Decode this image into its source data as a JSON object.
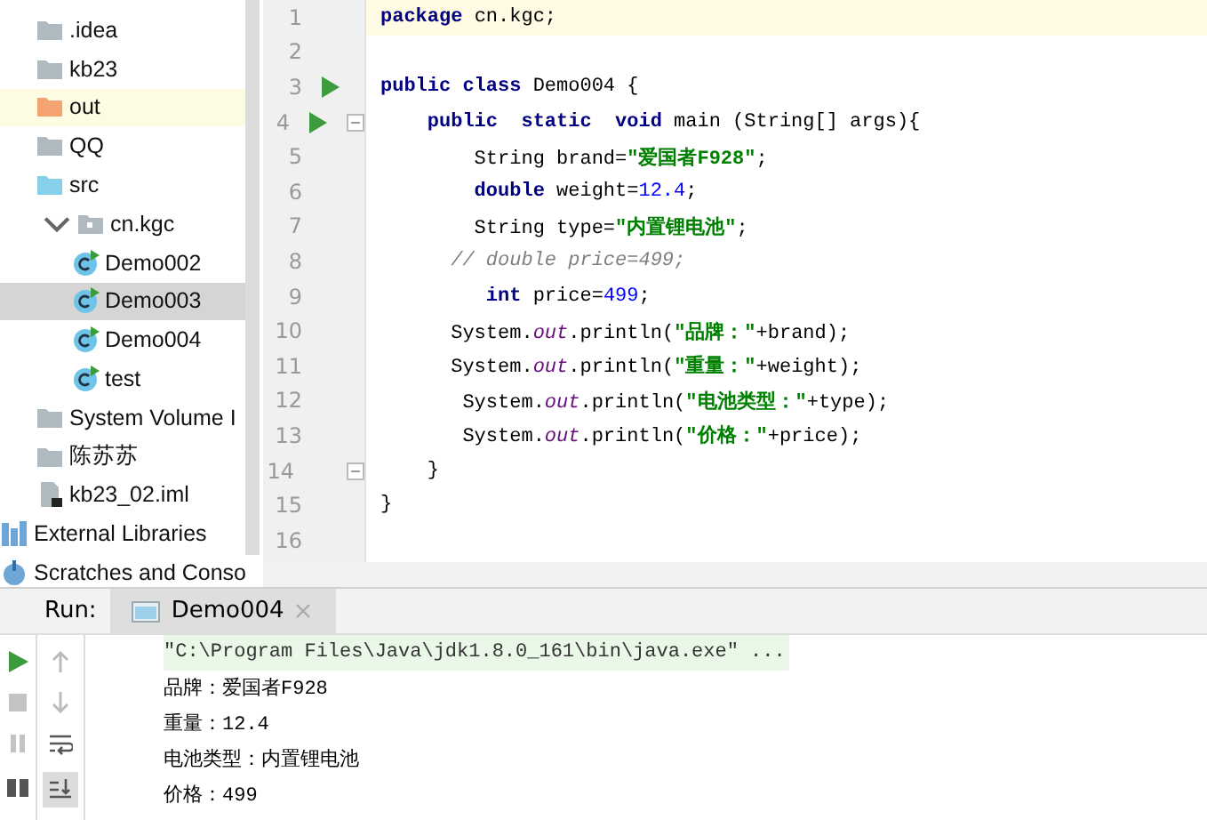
{
  "project_tree": [
    {
      "label": ".idea",
      "kind": "folder",
      "highlighted": false,
      "selected": false
    },
    {
      "label": "kb23",
      "kind": "folder",
      "highlighted": false,
      "selected": false
    },
    {
      "label": "out",
      "kind": "excluded_folder",
      "highlighted": true,
      "selected": false
    },
    {
      "label": "QQ",
      "kind": "folder",
      "highlighted": false,
      "selected": false
    },
    {
      "label": "src",
      "kind": "source_folder",
      "highlighted": false,
      "selected": false
    },
    {
      "label": "cn.kgc",
      "kind": "package",
      "highlighted": false,
      "selected": false,
      "expanded": true,
      "children": [
        {
          "label": "Demo002",
          "kind": "class",
          "highlighted": false,
          "selected": false
        },
        {
          "label": "Demo003",
          "kind": "class",
          "highlighted": false,
          "selected": true
        },
        {
          "label": "Demo004",
          "kind": "class",
          "highlighted": false,
          "selected": false
        },
        {
          "label": "test",
          "kind": "class",
          "highlighted": false,
          "selected": false
        }
      ]
    },
    {
      "label": "System Volume I",
      "kind": "folder",
      "highlighted": false,
      "selected": false
    },
    {
      "label": "陈苏苏",
      "kind": "folder",
      "highlighted": false,
      "selected": false
    },
    {
      "label": "kb23_02.iml",
      "kind": "file",
      "highlighted": false,
      "selected": false
    }
  ],
  "root_items": [
    {
      "label": "External Libraries",
      "kind": "library",
      "highlighted": false,
      "selected": false
    },
    {
      "label": "Scratches and Conso",
      "kind": "scratches",
      "highlighted": false,
      "selected": false
    }
  ],
  "editor": {
    "lines": [
      {
        "number": "1",
        "current": true,
        "run": false,
        "fold": false,
        "tokens": [
          {
            "text": "package",
            "kind": "kw"
          },
          {
            "text": " cn.kgc;",
            "kind": "plain"
          }
        ]
      },
      {
        "number": "2",
        "current": false,
        "run": false,
        "fold": false
      },
      {
        "number": "3",
        "current": false,
        "run": true,
        "fold": false,
        "tokens": [
          {
            "text": "public class",
            "kind": "kw"
          },
          {
            "text": " Demo004 {",
            "kind": "plain"
          }
        ]
      },
      {
        "number": "4",
        "current": false,
        "run": true,
        "fold": true,
        "tokens": [
          {
            "text": "    public  static  void",
            "kind": "kw"
          },
          {
            "text": " main (String[] args){",
            "kind": "plain"
          }
        ]
      },
      {
        "number": "5",
        "current": false,
        "run": false,
        "fold": false,
        "tokens": [
          {
            "text": "        String brand=",
            "kind": "plain"
          },
          {
            "text": "\"爱国者F928\"",
            "kind": "str"
          },
          {
            "text": ";",
            "kind": "plain"
          }
        ]
      },
      {
        "number": "6",
        "current": false,
        "run": false,
        "fold": false,
        "tokens": [
          {
            "text": "        double",
            "kind": "kw"
          },
          {
            "text": " weight=",
            "kind": "plain"
          },
          {
            "text": "12.4",
            "kind": "num"
          },
          {
            "text": ";",
            "kind": "plain"
          }
        ]
      },
      {
        "number": "7",
        "current": false,
        "run": false,
        "fold": false,
        "tokens": [
          {
            "text": "        String type=",
            "kind": "plain"
          },
          {
            "text": "\"内置锂电池\"",
            "kind": "str"
          },
          {
            "text": ";",
            "kind": "plain"
          }
        ]
      },
      {
        "number": "8",
        "current": false,
        "run": false,
        "fold": false,
        "tokens": [
          {
            "text": "      // double price=499;",
            "kind": "comment"
          }
        ]
      },
      {
        "number": "9",
        "current": false,
        "run": false,
        "fold": false,
        "tokens": [
          {
            "text": "         int",
            "kind": "kw"
          },
          {
            "text": " price=",
            "kind": "plain"
          },
          {
            "text": "499",
            "kind": "num"
          },
          {
            "text": ";",
            "kind": "plain"
          }
        ]
      },
      {
        "number": "10",
        "current": false,
        "run": false,
        "fold": false,
        "tokens": [
          {
            "text": "      System.",
            "kind": "plain"
          },
          {
            "text": "out",
            "kind": "field"
          },
          {
            "text": ".println(",
            "kind": "plain"
          },
          {
            "text": "\"品牌：\"",
            "kind": "str"
          },
          {
            "text": "+brand);",
            "kind": "plain"
          }
        ]
      },
      {
        "number": "11",
        "current": false,
        "run": false,
        "fold": false,
        "tokens": [
          {
            "text": "      System.",
            "kind": "plain"
          },
          {
            "text": "out",
            "kind": "field"
          },
          {
            "text": ".println(",
            "kind": "plain"
          },
          {
            "text": "\"重量：\"",
            "kind": "str"
          },
          {
            "text": "+weight);",
            "kind": "plain"
          }
        ]
      },
      {
        "number": "12",
        "current": false,
        "run": false,
        "fold": false,
        "tokens": [
          {
            "text": "       System.",
            "kind": "plain"
          },
          {
            "text": "out",
            "kind": "field"
          },
          {
            "text": ".println(",
            "kind": "plain"
          },
          {
            "text": "\"电池类型：\"",
            "kind": "str"
          },
          {
            "text": "+type);",
            "kind": "plain"
          }
        ]
      },
      {
        "number": "13",
        "current": false,
        "run": false,
        "fold": false,
        "tokens": [
          {
            "text": "       System.",
            "kind": "plain"
          },
          {
            "text": "out",
            "kind": "field"
          },
          {
            "text": ".println(",
            "kind": "plain"
          },
          {
            "text": "\"价格：\"",
            "kind": "str"
          },
          {
            "text": "+price);",
            "kind": "plain"
          }
        ]
      },
      {
        "number": "14",
        "current": false,
        "run": false,
        "fold": true,
        "tokens": [
          {
            "text": "    }",
            "kind": "plain"
          }
        ]
      },
      {
        "number": "15",
        "current": false,
        "run": false,
        "fold": false,
        "tokens": [
          {
            "text": "}",
            "kind": "plain"
          }
        ]
      },
      {
        "number": "16",
        "current": false,
        "run": false,
        "fold": false
      }
    ]
  },
  "run_panel": {
    "label": "Run:",
    "tabs": [
      {
        "label": "Demo004",
        "selected": true
      }
    ],
    "console": [
      {
        "text": "\"C:\\Program Files\\Java\\jdk1.8.0_161\\bin\\java.exe\" ...",
        "kind": "command"
      },
      {
        "text": "品牌：爱国者F928",
        "kind": "output"
      },
      {
        "text": "重量：12.4",
        "kind": "output"
      },
      {
        "text": "电池类型：内置锂电池",
        "kind": "output"
      },
      {
        "text": "价格：499",
        "kind": "output"
      }
    ]
  }
}
